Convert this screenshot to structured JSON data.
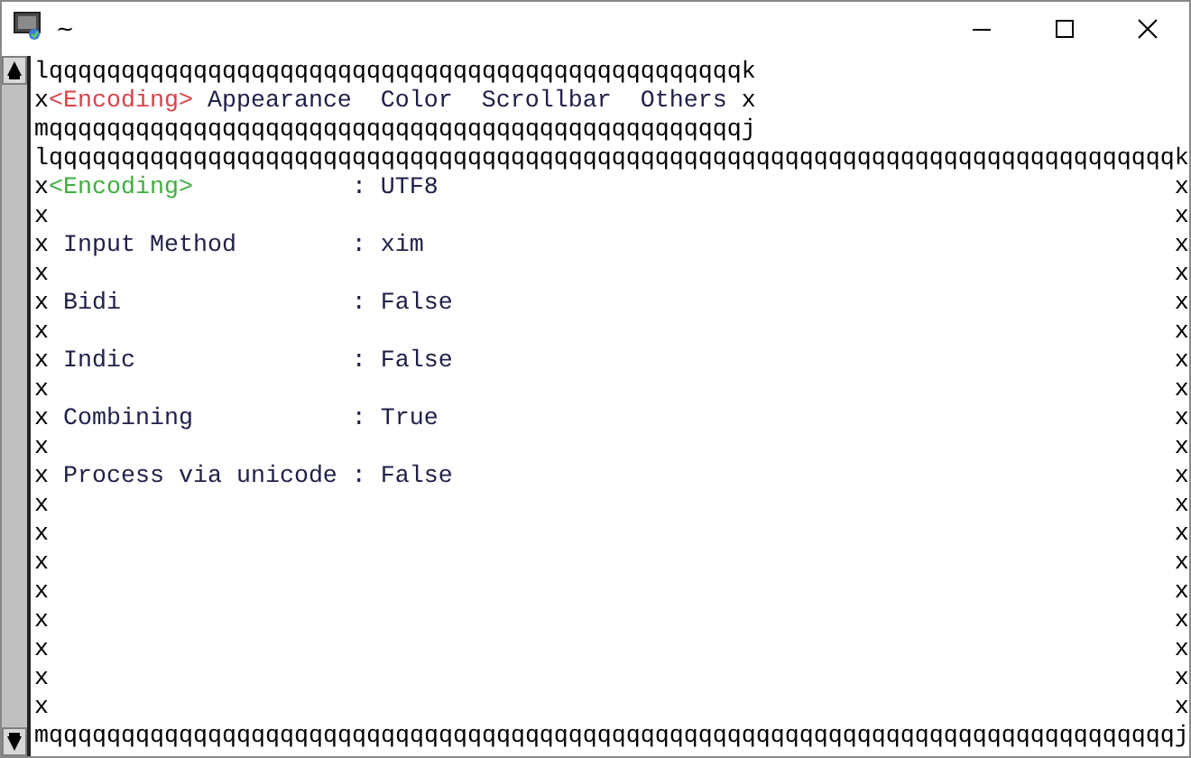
{
  "window": {
    "title": "~"
  },
  "tab_box": {
    "top": "lqqqqqqqqqqqqqqqqqqqqqqqqqqqqqqqqqqqqqqqqqqqqqqqqk",
    "left": "x",
    "right": "x",
    "bottom": "mqqqqqqqqqqqqqqqqqqqqqqqqqqqqqqqqqqqqqqqqqqqqqqqqj"
  },
  "tabs": [
    {
      "label": "<Encoding>",
      "selected": true
    },
    {
      "label": "Appearance",
      "selected": false
    },
    {
      "label": "Color",
      "selected": false
    },
    {
      "label": "Scrollbar",
      "selected": false
    },
    {
      "label": "Others",
      "selected": false
    }
  ],
  "panel": {
    "top": "lqqqqqqqqqqqqqqqqqqqqqqqqqqqqqqqqqqqqqqqqqqqqqqqqqqqqqqqqqqqqqqqqqqqqqqqqqqqqqqk",
    "bottom": "mqqqqqqqqqqqqqqqqqqqqqqqqqqqqqqqqqqqqqqqqqqqqqqqqqqqqqqqqqqqqqqqqqqqqqqqqqqqqqqj",
    "lines": [
      {
        "kind": "heading",
        "left": "x",
        "label": "<Encoding>",
        "separator": ":",
        "value": "UTF8",
        "right": "x"
      },
      {
        "kind": "blank",
        "left": "x",
        "right": "x"
      },
      {
        "kind": "setting",
        "left": "x",
        "label": "Input Method",
        "separator": ":",
        "value": "xim",
        "right": "x"
      },
      {
        "kind": "blank",
        "left": "x",
        "right": "x"
      },
      {
        "kind": "setting",
        "left": "x",
        "label": "Bidi",
        "separator": ":",
        "value": "False",
        "right": "x"
      },
      {
        "kind": "blank",
        "left": "x",
        "right": "x"
      },
      {
        "kind": "setting",
        "left": "x",
        "label": "Indic",
        "separator": ":",
        "value": "False",
        "right": "x"
      },
      {
        "kind": "blank",
        "left": "x",
        "right": "x"
      },
      {
        "kind": "setting",
        "left": "x",
        "label": "Combining",
        "separator": ":",
        "value": "True",
        "right": "x"
      },
      {
        "kind": "blank",
        "left": "x",
        "right": "x"
      },
      {
        "kind": "setting",
        "left": "x",
        "label": "Process via unicode",
        "separator": ":",
        "value": "False",
        "right": "x"
      },
      {
        "kind": "blank",
        "left": "x",
        "right": "x"
      },
      {
        "kind": "blank",
        "left": "x",
        "right": "x"
      },
      {
        "kind": "blank",
        "left": "x",
        "right": "x"
      },
      {
        "kind": "blank",
        "left": "x",
        "right": "x"
      },
      {
        "kind": "blank",
        "left": "x",
        "right": "x"
      },
      {
        "kind": "blank",
        "left": "x",
        "right": "x"
      },
      {
        "kind": "blank",
        "left": "x",
        "right": "x"
      },
      {
        "kind": "blank",
        "left": "x",
        "right": "x"
      }
    ]
  }
}
